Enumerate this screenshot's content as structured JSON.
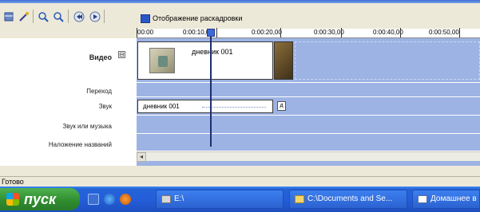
{
  "toolbar": {
    "buttons": [
      {
        "name": "storyboard-icon"
      },
      {
        "name": "wand-icon"
      },
      {
        "name": "zoom-in-icon"
      },
      {
        "name": "zoom-out-icon"
      },
      {
        "name": "rewind-icon"
      },
      {
        "name": "play-icon"
      }
    ],
    "storyboard_label": "Отображение раскадровки"
  },
  "ruler": {
    "ticks": [
      "00:00",
      "0:00:10,00",
      "0:00:20,00",
      "0:00:30,00",
      "0:00:40,00",
      "0:00:50,00"
    ]
  },
  "tracks": {
    "video": "Видео",
    "transition": "Переход",
    "audio": "Звук",
    "music": "Звук или музыка",
    "titles": "Наложение названий",
    "collapse_symbol": "⊟"
  },
  "video_clip": {
    "name": "дневник 001"
  },
  "audio_clip": {
    "name": "дневник 001",
    "end_label": "д"
  },
  "status": {
    "text": "Готово"
  },
  "taskbar": {
    "start_label": "пуск",
    "tasks": [
      {
        "label": "E:\\"
      },
      {
        "label": "C:\\Documents and Se..."
      },
      {
        "label": "Домашнее в"
      }
    ]
  },
  "colors": {
    "timeline_bg": "#9db3e4",
    "taskbar_blue": "#245edb",
    "start_green": "#2e8b2e"
  }
}
